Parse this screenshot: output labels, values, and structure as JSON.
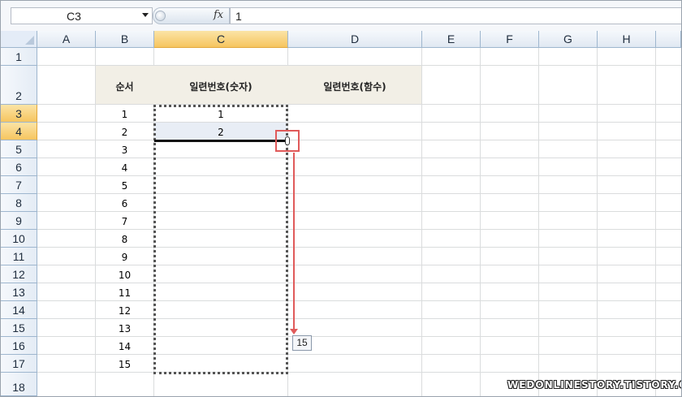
{
  "formula_bar": {
    "name_box": "C3",
    "fx_label": "fx",
    "value": "1"
  },
  "columns": [
    "A",
    "B",
    "C",
    "D",
    "E",
    "F",
    "G",
    "H"
  ],
  "selected_column": "C",
  "rows": [
    "1",
    "2",
    "3",
    "4",
    "5",
    "6",
    "7",
    "8",
    "9",
    "10",
    "11",
    "12",
    "13",
    "14",
    "15",
    "16",
    "17",
    "18"
  ],
  "selected_rows": [
    "3",
    "4"
  ],
  "sheet": {
    "header_b": "순서",
    "header_c": "일련번호(숫자)",
    "header_d": "일련번호(함수)",
    "b_values": [
      "1",
      "2",
      "3",
      "4",
      "5",
      "6",
      "7",
      "8",
      "9",
      "10",
      "11",
      "12",
      "13",
      "14",
      "15"
    ],
    "c_values": [
      "1",
      "2"
    ]
  },
  "fill_tooltip": "15",
  "watermark": "WEDONLINESTORY.TISTORY.COM",
  "colors": {
    "header_fill": "#f2efe6",
    "selected_header": "#f6c55f",
    "drag_indicator": "#e05a5a"
  }
}
